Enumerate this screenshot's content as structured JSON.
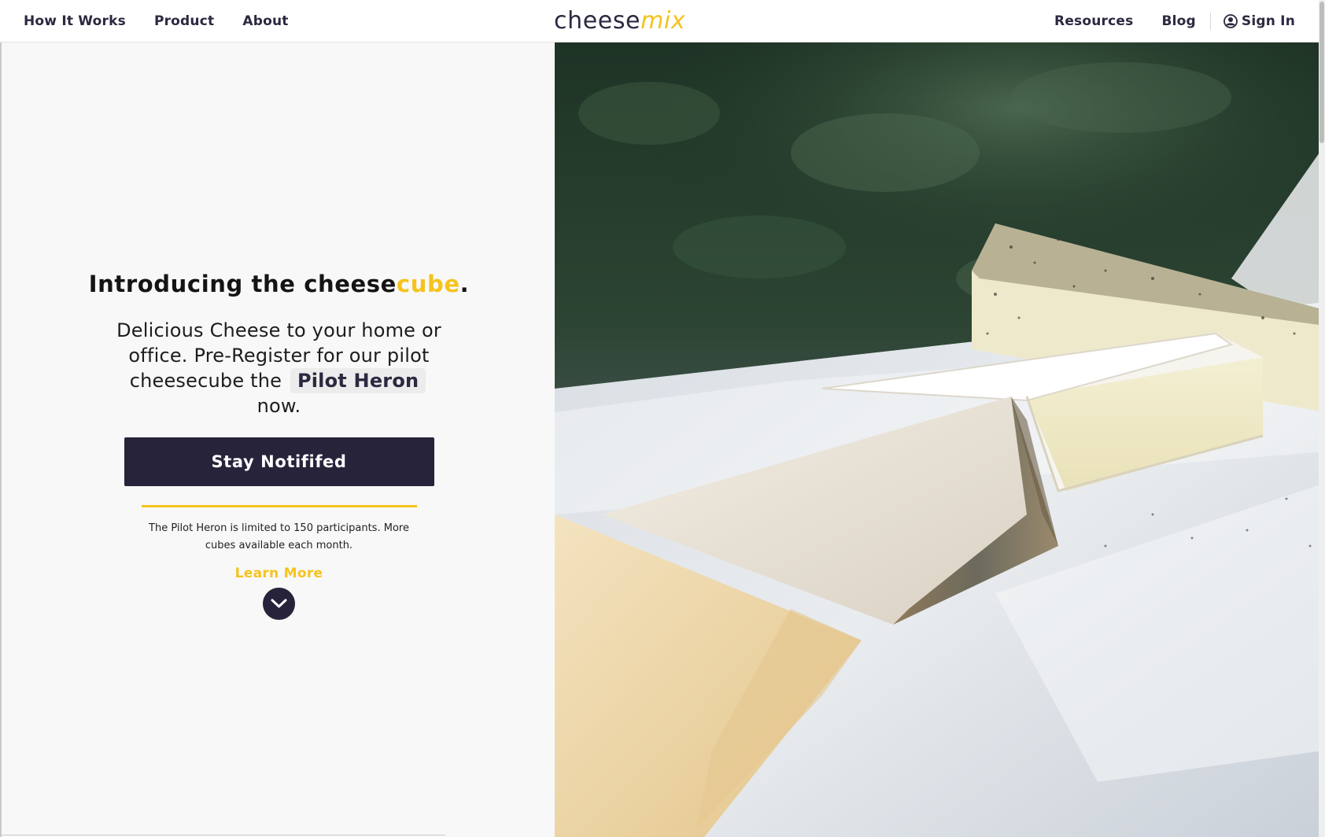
{
  "nav": {
    "left": [
      {
        "label": "How It Works"
      },
      {
        "label": "Product"
      },
      {
        "label": "About"
      }
    ],
    "right": [
      {
        "label": "Resources"
      },
      {
        "label": "Blog"
      }
    ],
    "signin_label": "Sign In",
    "user_icon": "user-circle-icon"
  },
  "logo": {
    "main": "cheese",
    "accent": "mix"
  },
  "hero": {
    "headline_prefix": "Introducing the cheese",
    "headline_accent": "cube",
    "headline_suffix": ".",
    "subcopy_before": "Delicious Cheese to your home or office. Pre-Register for our pilot cheesecube the",
    "subcopy_highlight": "Pilot Heron",
    "subcopy_after": "now.",
    "cta_label": "Stay Notififed",
    "note": "The Pilot Heron is limited to 150 participants. More cubes available each month.",
    "learn_more_label": "Learn More",
    "learn_more_icon": "chevron-down-icon"
  },
  "colors": {
    "accent": "#f6c31c",
    "dark": "#26233a",
    "panel_bg": "#f8f8f8"
  }
}
